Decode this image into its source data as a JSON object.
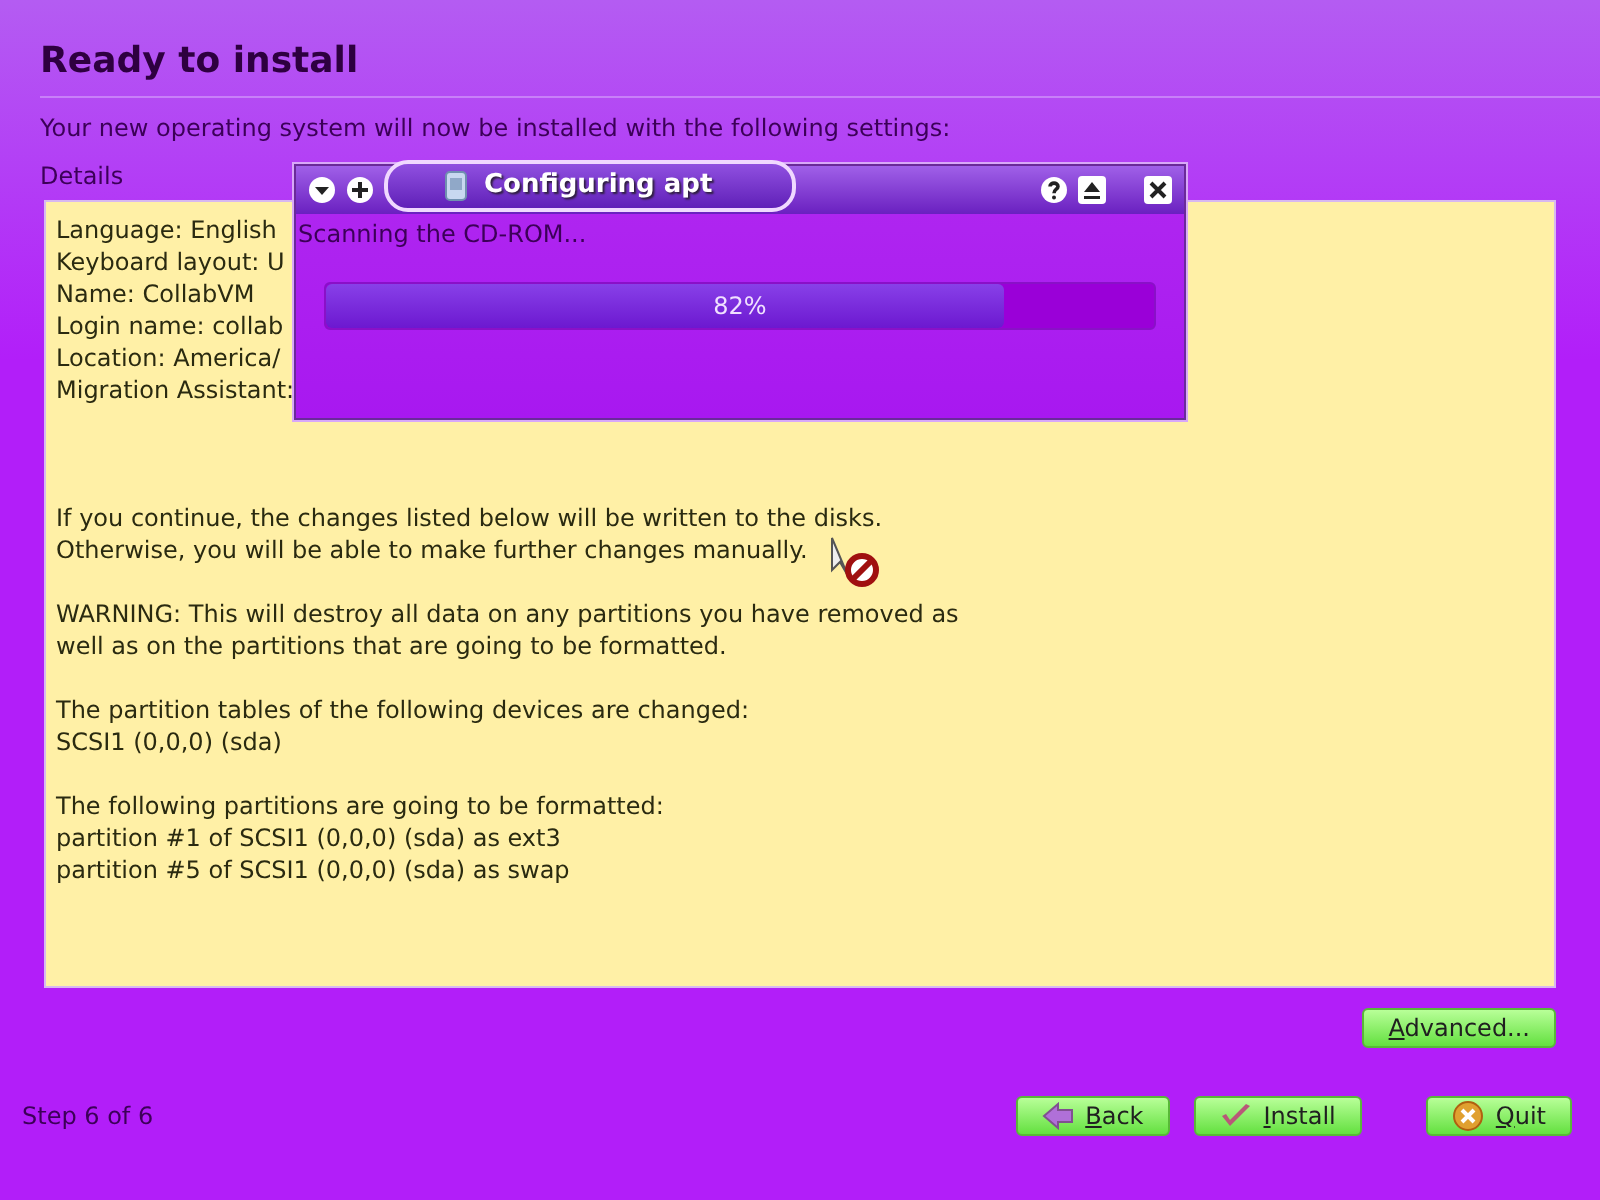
{
  "page": {
    "title": "Ready to install",
    "subtitle": "Your new operating system will now be installed with the following settings:",
    "details_label": "Details"
  },
  "details": {
    "summary": [
      "Language: English",
      "Keyboard layout: U",
      "Name: CollabVM",
      "Login name: collab",
      "Location: America/",
      "Migration Assistant:"
    ],
    "paragraphs": [
      [
        "If you continue, the changes listed below will be written to the disks.",
        "Otherwise, you will be able to make further changes manually."
      ],
      [
        "WARNING: This will destroy all data on any partitions you have removed as",
        "well as on the partitions that are going to be formatted."
      ],
      [
        "The partition tables of the following devices are changed:",
        "SCSI1 (0,0,0) (sda)"
      ],
      [
        "The following partitions are going to be formatted:",
        "partition #1 of SCSI1 (0,0,0) (sda) as ext3",
        "partition #5 of SCSI1 (0,0,0) (sda) as swap"
      ]
    ]
  },
  "advanced_button": "Advanced...",
  "step": "Step 6 of 6",
  "buttons": [
    {
      "label": "Back",
      "kind": "back"
    },
    {
      "label": "Install",
      "kind": "install"
    },
    {
      "label": "Quit",
      "kind": "quit"
    }
  ],
  "dialog": {
    "title": "Configuring apt",
    "message": "Scanning the CD-ROM...",
    "progress": {
      "level": 0.82,
      "reading": "82%"
    }
  }
}
